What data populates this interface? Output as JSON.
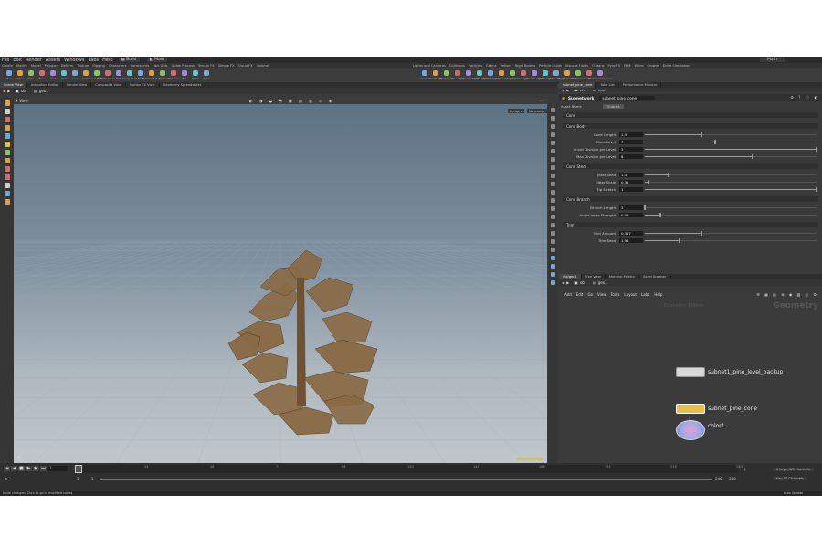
{
  "menu": [
    "File",
    "Edit",
    "Render",
    "Assets",
    "Windows",
    "Labs",
    "Help"
  ],
  "desktop": "Build",
  "scene_menu": "Main",
  "shelf_tabs_left": [
    "Create",
    "Modify",
    "Model",
    "Polygon",
    "Deform",
    "Texture",
    "Rigging",
    "Characters",
    "Constraints",
    "Hair Utils",
    "Guide Process",
    "Terrain FX",
    "Simple FX",
    "Cloud FX",
    "Volume"
  ],
  "shelf_tools_left": [
    "Box",
    "Sphere",
    "Tube",
    "Torus",
    "Grid",
    "Null",
    "Line",
    "Circle",
    "Curve Bezier",
    "Draw Curve",
    "Path",
    "Spray Paint",
    "Font",
    "Platonic Solids",
    "L-System",
    "Metaball",
    "File",
    "Spiral",
    "Helix"
  ],
  "shelf_tabs_right": [
    "Lights and Cameras",
    "Collisions",
    "Particles",
    "Grains",
    "Vellum",
    "Rigid Bodies",
    "Particle Fluids",
    "Viscous Fluids",
    "Oceans",
    "Pyro FX",
    "FEM",
    "Wires",
    "Crowds",
    "Drive Simulation"
  ],
  "shelf_tools_right": [
    "Camera",
    "Point Light",
    "Spot Light",
    "Area Light",
    "Geometry Light",
    "Volume Light",
    "Distant Light",
    "Environment Light",
    "Sky Light",
    "GI Light",
    "Caustic Light",
    "Portal Light",
    "Ambient Light",
    "Stereo Camera",
    "VR Camera",
    "Switcher",
    "Gamepad Camera"
  ],
  "viewport_tabs": [
    "Scene View",
    "Animation Editor",
    "Render View",
    "Composite View",
    "Motion FX View",
    "Geometry Spreadsheet"
  ],
  "viewport_path": {
    "context": "obj",
    "node": "geo1"
  },
  "viewport_label": "View",
  "viewport_persp": "Persp ▾",
  "viewport_cam": "No cam ▾",
  "param_tabs": [
    "subnet_pine_cone",
    "Take List",
    "Performance Monitor"
  ],
  "param_path": {
    "context": "obj",
    "node": "geo1"
  },
  "param_header": {
    "type": "Subnetwork",
    "name": "subnet_pine_cone"
  },
  "asset_name_label": "Asset Name",
  "asset_name_button": "Subnet",
  "sections": [
    {
      "title": "Cone",
      "params": []
    },
    {
      "title": "Cone Body",
      "params": [
        {
          "label": "Cone Length",
          "value": "1.3",
          "fill": 0.33
        },
        {
          "label": "Cone Level",
          "value": "7",
          "fill": 0.41
        },
        {
          "label": "Inner Division per Level",
          "value": "3",
          "fill": 1.0
        },
        {
          "label": "Max Division per Level",
          "value": "8",
          "fill": 0.63
        }
      ]
    },
    {
      "title": "Cone Stem",
      "params": [
        {
          "label": "Jitter Seed",
          "value": "1.4",
          "fill": 0.14
        },
        {
          "label": "Jitter Scale",
          "value": "0.31",
          "fill": 0.02
        },
        {
          "label": "Tip Stretch",
          "value": "1",
          "fill": 1.0
        }
      ]
    },
    {
      "title": "Cone Branch",
      "params": [
        {
          "label": "Branch Length",
          "value": "3",
          "fill": 0.0
        },
        {
          "label": "Angle Inner Strength",
          "value": "0.09",
          "fill": 0.09
        }
      ]
    },
    {
      "title": "Trim",
      "params": [
        {
          "label": "Trim Amount",
          "value": "0.317",
          "fill": 0.33
        },
        {
          "label": "Trim Seed",
          "value": "1.94",
          "fill": 0.2
        }
      ]
    }
  ],
  "net_tabs": [
    "obj/geo1",
    "Tree View",
    "Material Palette",
    "Asset Browser"
  ],
  "net_path": {
    "context": "obj",
    "node": "geo1"
  },
  "net_menu": [
    "Add",
    "Edit",
    "Go",
    "View",
    "Tools",
    "Layout",
    "Labs",
    "Help"
  ],
  "net_watermark": "Education Edition",
  "net_context_label": "Geometry",
  "nodes": [
    {
      "name": "subnet1_pine_level_backup",
      "color": "#d8d8d8"
    },
    {
      "name": "subnet_pine_cone",
      "color": "#e6c04a"
    },
    {
      "name": "color1",
      "color": "#c9c2e6"
    }
  ],
  "timeline": {
    "frame": "1",
    "start": "1",
    "start2": "1",
    "end": "240",
    "end2": "240",
    "ticks": [
      "1",
      "24",
      "48",
      "72",
      "96",
      "120",
      "144",
      "168",
      "192",
      "216",
      "240"
    ],
    "keys_label": "0 keys, 0/0 channels",
    "key_all_label": "Key All Channels",
    "auto_update": "Auto Update"
  },
  "status_text": "Node changed. Click to go to modified nodes.",
  "colors": {
    "cone_brown": "#8a6a45",
    "selected_node": "#e6c04a",
    "slider_fill": "#6aa8d8"
  }
}
